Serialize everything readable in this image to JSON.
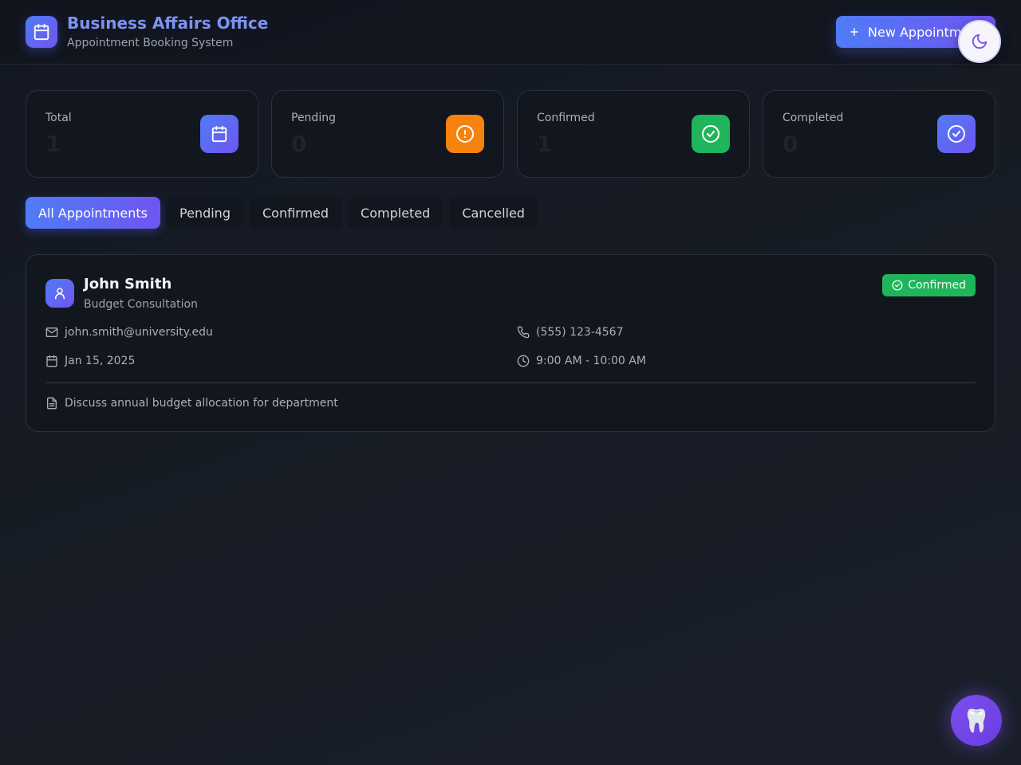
{
  "header": {
    "title": "Business Affairs Office",
    "subtitle": "Appointment Booking System",
    "new_button_label": "New Appointment",
    "logo_icon": "calendar-icon",
    "theme_icon": "moon-icon"
  },
  "stats": [
    {
      "label": "Total",
      "value": "1",
      "icon": "calendar-icon",
      "color": "#5b6cf5"
    },
    {
      "label": "Pending",
      "value": "0",
      "icon": "alert-circle-icon",
      "color": "#f5830e"
    },
    {
      "label": "Confirmed",
      "value": "1",
      "icon": "check-circle-icon",
      "color": "#20b55c"
    },
    {
      "label": "Completed",
      "value": "0",
      "icon": "check-circle-icon",
      "color": "#4f7cf7"
    }
  ],
  "tabs": [
    {
      "label": "All Appointments",
      "active": true
    },
    {
      "label": "Pending",
      "active": false
    },
    {
      "label": "Confirmed",
      "active": false
    },
    {
      "label": "Completed",
      "active": false
    },
    {
      "label": "Cancelled",
      "active": false
    }
  ],
  "appointments": [
    {
      "name": "John Smith",
      "service": "Budget Consultation",
      "status": "Confirmed",
      "email": "john.smith@university.edu",
      "phone": "(555) 123-4567",
      "date": "Jan 15, 2025",
      "time": "9:00 AM - 10:00 AM",
      "notes": "Discuss annual budget allocation for department"
    }
  ],
  "fab": {
    "icon": "🦷"
  },
  "colors": {
    "accent": "#5b6cf5",
    "success": "#20b55c",
    "warning": "#f5830e",
    "fab": "#7c4ff0"
  }
}
